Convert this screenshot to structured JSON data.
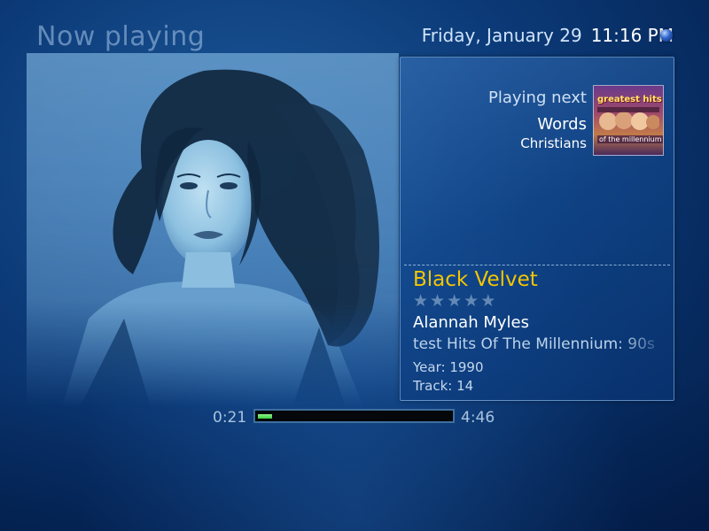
{
  "screen": {
    "title": "Now playing",
    "date": "Friday, January 29",
    "time": "11:16 PM"
  },
  "playing_next": {
    "label": "Playing next",
    "title": "Words",
    "artist": "Christians",
    "cover_text_top": "greatest hits",
    "cover_text_bottom": "of the millennium"
  },
  "now_playing": {
    "title": "Black Velvet",
    "rating": 0,
    "rating_max": 5,
    "artist": "Alannah Myles",
    "album": "test Hits Of The Millennium: 90s",
    "year": "Year: 1990",
    "track": "Track: 14"
  },
  "progress": {
    "elapsed": "0:21",
    "total": "4:46",
    "fraction": 0.074
  },
  "colors": {
    "accent_title": "#f5c500",
    "progress_fill": "#3fd03f",
    "background": "#0c3a78"
  },
  "icons": {
    "status": "orb-icon",
    "rating": "star-icon"
  }
}
